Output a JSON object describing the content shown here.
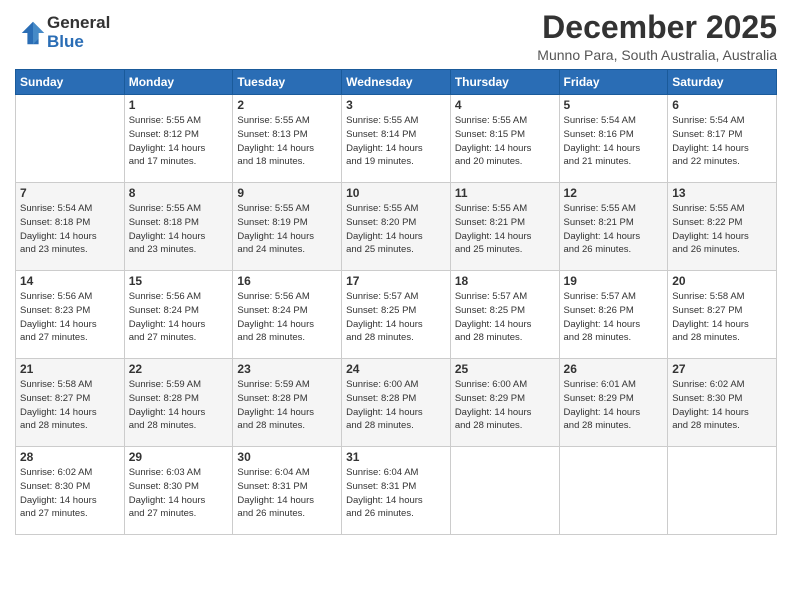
{
  "logo": {
    "general": "General",
    "blue": "Blue"
  },
  "title": {
    "month": "December 2025",
    "location": "Munno Para, South Australia, Australia"
  },
  "weekdays": [
    "Sunday",
    "Monday",
    "Tuesday",
    "Wednesday",
    "Thursday",
    "Friday",
    "Saturday"
  ],
  "weeks": [
    [
      {
        "day": "",
        "info": ""
      },
      {
        "day": "1",
        "info": "Sunrise: 5:55 AM\nSunset: 8:12 PM\nDaylight: 14 hours\nand 17 minutes."
      },
      {
        "day": "2",
        "info": "Sunrise: 5:55 AM\nSunset: 8:13 PM\nDaylight: 14 hours\nand 18 minutes."
      },
      {
        "day": "3",
        "info": "Sunrise: 5:55 AM\nSunset: 8:14 PM\nDaylight: 14 hours\nand 19 minutes."
      },
      {
        "day": "4",
        "info": "Sunrise: 5:55 AM\nSunset: 8:15 PM\nDaylight: 14 hours\nand 20 minutes."
      },
      {
        "day": "5",
        "info": "Sunrise: 5:54 AM\nSunset: 8:16 PM\nDaylight: 14 hours\nand 21 minutes."
      },
      {
        "day": "6",
        "info": "Sunrise: 5:54 AM\nSunset: 8:17 PM\nDaylight: 14 hours\nand 22 minutes."
      }
    ],
    [
      {
        "day": "7",
        "info": "Sunrise: 5:54 AM\nSunset: 8:18 PM\nDaylight: 14 hours\nand 23 minutes."
      },
      {
        "day": "8",
        "info": "Sunrise: 5:55 AM\nSunset: 8:18 PM\nDaylight: 14 hours\nand 23 minutes."
      },
      {
        "day": "9",
        "info": "Sunrise: 5:55 AM\nSunset: 8:19 PM\nDaylight: 14 hours\nand 24 minutes."
      },
      {
        "day": "10",
        "info": "Sunrise: 5:55 AM\nSunset: 8:20 PM\nDaylight: 14 hours\nand 25 minutes."
      },
      {
        "day": "11",
        "info": "Sunrise: 5:55 AM\nSunset: 8:21 PM\nDaylight: 14 hours\nand 25 minutes."
      },
      {
        "day": "12",
        "info": "Sunrise: 5:55 AM\nSunset: 8:21 PM\nDaylight: 14 hours\nand 26 minutes."
      },
      {
        "day": "13",
        "info": "Sunrise: 5:55 AM\nSunset: 8:22 PM\nDaylight: 14 hours\nand 26 minutes."
      }
    ],
    [
      {
        "day": "14",
        "info": "Sunrise: 5:56 AM\nSunset: 8:23 PM\nDaylight: 14 hours\nand 27 minutes."
      },
      {
        "day": "15",
        "info": "Sunrise: 5:56 AM\nSunset: 8:24 PM\nDaylight: 14 hours\nand 27 minutes."
      },
      {
        "day": "16",
        "info": "Sunrise: 5:56 AM\nSunset: 8:24 PM\nDaylight: 14 hours\nand 28 minutes."
      },
      {
        "day": "17",
        "info": "Sunrise: 5:57 AM\nSunset: 8:25 PM\nDaylight: 14 hours\nand 28 minutes."
      },
      {
        "day": "18",
        "info": "Sunrise: 5:57 AM\nSunset: 8:25 PM\nDaylight: 14 hours\nand 28 minutes."
      },
      {
        "day": "19",
        "info": "Sunrise: 5:57 AM\nSunset: 8:26 PM\nDaylight: 14 hours\nand 28 minutes."
      },
      {
        "day": "20",
        "info": "Sunrise: 5:58 AM\nSunset: 8:27 PM\nDaylight: 14 hours\nand 28 minutes."
      }
    ],
    [
      {
        "day": "21",
        "info": "Sunrise: 5:58 AM\nSunset: 8:27 PM\nDaylight: 14 hours\nand 28 minutes."
      },
      {
        "day": "22",
        "info": "Sunrise: 5:59 AM\nSunset: 8:28 PM\nDaylight: 14 hours\nand 28 minutes."
      },
      {
        "day": "23",
        "info": "Sunrise: 5:59 AM\nSunset: 8:28 PM\nDaylight: 14 hours\nand 28 minutes."
      },
      {
        "day": "24",
        "info": "Sunrise: 6:00 AM\nSunset: 8:28 PM\nDaylight: 14 hours\nand 28 minutes."
      },
      {
        "day": "25",
        "info": "Sunrise: 6:00 AM\nSunset: 8:29 PM\nDaylight: 14 hours\nand 28 minutes."
      },
      {
        "day": "26",
        "info": "Sunrise: 6:01 AM\nSunset: 8:29 PM\nDaylight: 14 hours\nand 28 minutes."
      },
      {
        "day": "27",
        "info": "Sunrise: 6:02 AM\nSunset: 8:30 PM\nDaylight: 14 hours\nand 28 minutes."
      }
    ],
    [
      {
        "day": "28",
        "info": "Sunrise: 6:02 AM\nSunset: 8:30 PM\nDaylight: 14 hours\nand 27 minutes."
      },
      {
        "day": "29",
        "info": "Sunrise: 6:03 AM\nSunset: 8:30 PM\nDaylight: 14 hours\nand 27 minutes."
      },
      {
        "day": "30",
        "info": "Sunrise: 6:04 AM\nSunset: 8:31 PM\nDaylight: 14 hours\nand 26 minutes."
      },
      {
        "day": "31",
        "info": "Sunrise: 6:04 AM\nSunset: 8:31 PM\nDaylight: 14 hours\nand 26 minutes."
      },
      {
        "day": "",
        "info": ""
      },
      {
        "day": "",
        "info": ""
      },
      {
        "day": "",
        "info": ""
      }
    ]
  ]
}
